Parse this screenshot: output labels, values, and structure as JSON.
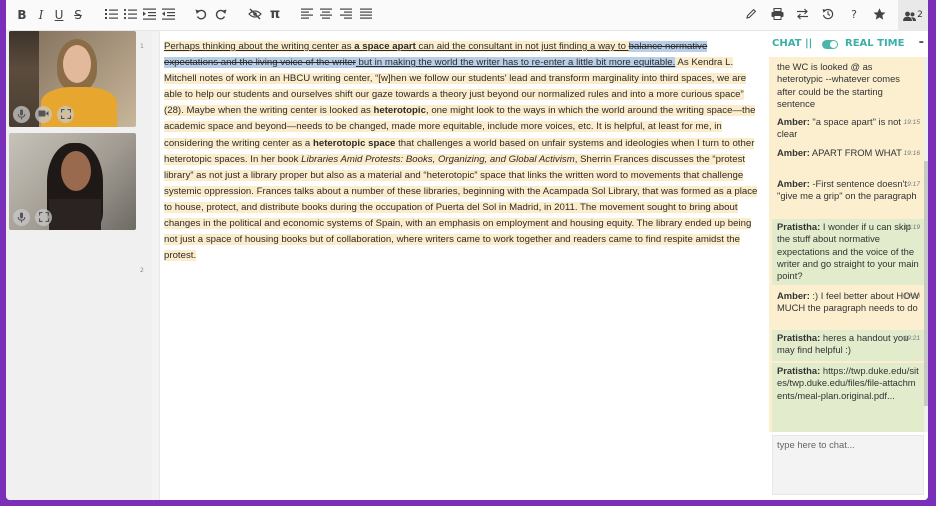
{
  "toolbar": {
    "left": [
      {
        "name": "bold-button",
        "glyph": "B"
      },
      {
        "name": "italic-button",
        "glyph": "I"
      },
      {
        "name": "underline-button",
        "glyph": "U"
      },
      {
        "name": "strikethrough-button",
        "glyph": "S"
      },
      {
        "name": "numbered-list-button",
        "icon": "numbered-list-icon"
      },
      {
        "name": "bullet-list-button",
        "icon": "bullet-list-icon"
      },
      {
        "name": "indent-button",
        "icon": "indent-icon"
      },
      {
        "name": "outdent-button",
        "icon": "outdent-icon"
      },
      {
        "name": "undo-button",
        "icon": "undo-icon"
      },
      {
        "name": "redo-button",
        "icon": "redo-icon"
      },
      {
        "name": "hide-comments-button",
        "icon": "eye-slash-icon"
      },
      {
        "name": "show-formatting-button",
        "glyph": "π"
      },
      {
        "name": "align-left-button",
        "icon": "align-left-icon"
      },
      {
        "name": "align-center-button",
        "icon": "align-center-icon"
      },
      {
        "name": "align-right-button",
        "icon": "align-right-icon"
      },
      {
        "name": "justify-button",
        "icon": "justify-icon"
      }
    ],
    "right": [
      {
        "name": "pen-button",
        "icon": "pen-icon"
      },
      {
        "name": "print-button",
        "icon": "print-icon"
      },
      {
        "name": "swap-button",
        "icon": "swap-icon"
      },
      {
        "name": "history-button",
        "icon": "history-icon"
      },
      {
        "name": "help-button",
        "glyph": "?"
      },
      {
        "name": "star-button",
        "icon": "star-icon"
      }
    ],
    "user_count": "2"
  },
  "video": {
    "mic_icon": "microphone-icon",
    "camera_icon": "camera-icon",
    "fullscreen_icon": "fullscreen-icon"
  },
  "line_numbers": [
    "1",
    "2"
  ],
  "document": {
    "p1_a": "Perhaps thinking about the writing center as ",
    "p1_b": "a space apart",
    "p1_c": " can aid the consultant in not just finding a way to ",
    "p1_del1": "balance normative expectations and the living voice of the writer",
    "p1_d": " but in making the world the writer has to re-enter a little bit more equitable.",
    "p1_e": " As Kendra L. Mitchell notes of work in an HBCU writing center, “[w]hen we follow our students' lead and transform marginality into third spaces, we are able to help our students and ourselves shift our gaze towards a theory just beyond our normalized rules and into a more curious space” (28). Maybe when the writing center is looked as ",
    "p1_f": "heterotopic",
    "p1_g": ", one might look to the ways in which the world around the writing space—the academic space and beyond—needs to be changed, made more equitable, include more voices, etc. It is helpful, at least for me, in considering the writing center as a ",
    "p1_h": "heterotopic space",
    "p1_i": " that challenges a world based on unfair systems and ideologies when I turn to other heterotopic spaces. In her book ",
    "p1_j": "Libraries Amid Protests: Books, Organizing, and Global Activism",
    "p1_k": ", Sherrin Frances discusses the “protest library” as not just a library proper but also as a  material and “heterotopic” space that links the written word to movements that challenge systemic oppression. Frances talks about a number of these libraries, beginning with the Acampada Sol Library, that was formed as a place to house, protect, and distribute books during the occupation of Puerta del Sol in Madrid, in 2011. The movement sought to bring about changes in the political and economic systems of Spain, with an emphasis on employment and housing equity. The library ended up being not just a space of housing books but of collaboration, where writers came to work together and readers came to find respite amidst the protest."
  },
  "chat": {
    "label": "CHAT ||",
    "mode": "REAL TIME",
    "minimize": "-",
    "messages": [
      {
        "author": "",
        "text": "the WC is looked @ as heterotypic --whatever comes after could be the starting sentence",
        "time": ""
      },
      {
        "author": "Amber:",
        "text": " \"a space apart\" is not clear",
        "time": "19:15"
      },
      {
        "author": "Amber:",
        "text": " APART FROM WHAT",
        "time": "19:16"
      },
      {
        "author": "Amber:",
        "text": " -First sentence doesn't \"give me a grip\" on the paragraph",
        "time": "19:17"
      },
      {
        "author": "Pratistha:",
        "text": " I wonder if u can skip the stuff about normative expectations and the voice of the writer and go straight to your main point?",
        "time": "19:19"
      },
      {
        "author": "Amber:",
        "text": " :) I feel better about HOW MUCH the paragraph needs to do",
        "time": "19:20"
      },
      {
        "author": "Pratistha:",
        "text": " heres a handout you may find helpful :)",
        "time": "19:21"
      },
      {
        "author": "Pratistha:",
        "text": " https://twp.duke.edu/sites/twp.duke.edu/files/file-attachments/meal-plan.original.pdf...",
        "time": ""
      }
    ],
    "input_placeholder": "type here to chat..."
  }
}
